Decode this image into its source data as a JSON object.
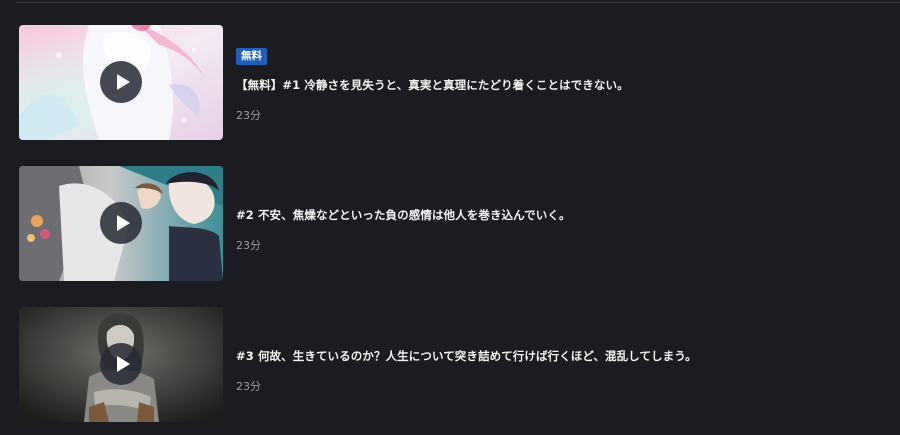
{
  "episodes": [
    {
      "badge": "無料",
      "title": "【無料】#1 冷静さを見失うと、真実と真理にたどり着くことはできない。",
      "duration": "23分"
    },
    {
      "title": "#2 不安、焦燥などといった負の感情は他人を巻き込んでいく。",
      "duration": "23分"
    },
    {
      "title": "#3 何故、生きているのか？人生について突き詰めて行けば行くほど、混乱してしまう。",
      "duration": "23分"
    }
  ],
  "icons": {
    "play": "play-icon"
  },
  "colors": {
    "background": "#1b1c22",
    "badge": "#1e5fb8",
    "title": "#f2f2f2",
    "duration": "#9a9ba3",
    "play_button": "#282a36"
  }
}
